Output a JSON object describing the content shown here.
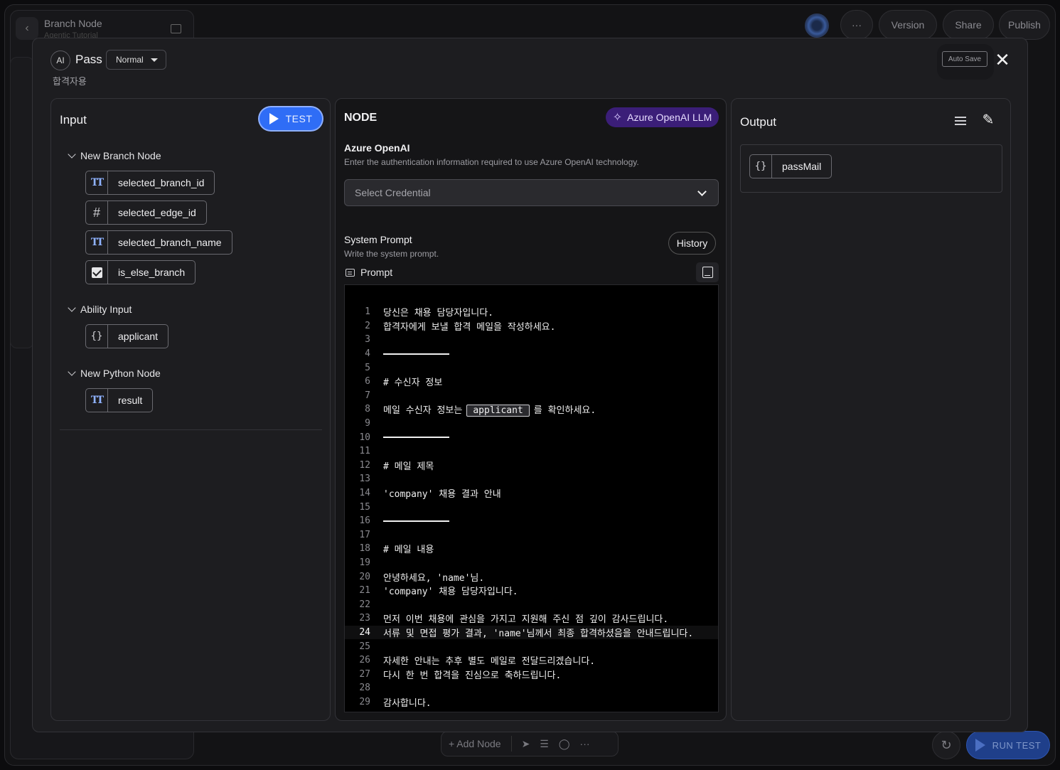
{
  "background": {
    "title": "Branch Node",
    "subtitle": "Agentic Tutorial",
    "top_buttons": {
      "more": "···",
      "version": "Version",
      "share": "Share",
      "publish": "Publish"
    },
    "bottom_toolbar": {
      "add_node": "+ Add Node"
    },
    "run_test": "RUN TEST"
  },
  "modal": {
    "ai_badge": "AI",
    "node_name": "Pass",
    "mode": "Normal",
    "description": "합격자용",
    "auto_save": "Auto Save",
    "close": "✕",
    "input_panel": {
      "title": "Input",
      "test_label": "TEST",
      "groups": [
        {
          "label": "New Branch Node",
          "items": [
            {
              "icon": "text-type-icon",
              "label": "selected_branch_id"
            },
            {
              "icon": "hash-icon",
              "label": "selected_edge_id"
            },
            {
              "icon": "text-type-icon",
              "label": "selected_branch_name"
            },
            {
              "icon": "checkbox-icon",
              "label": "is_else_branch"
            }
          ]
        },
        {
          "label": "Ability Input",
          "items": [
            {
              "icon": "object-braces-icon",
              "label": "applicant"
            }
          ]
        },
        {
          "label": "New Python Node",
          "items": [
            {
              "icon": "text-type-icon",
              "label": "result"
            }
          ]
        }
      ]
    },
    "node_panel": {
      "title": "NODE",
      "llm_badge": "Azure OpenAI LLM",
      "provider_title": "Azure OpenAI",
      "provider_desc": "Enter the authentication information required to use Azure OpenAI technology.",
      "credential_placeholder": "Select Credential",
      "system_prompt_title": "System Prompt",
      "system_prompt_desc": "Write the system prompt.",
      "history_label": "History",
      "prompt_label": "Prompt",
      "active_line": 24,
      "lines": [
        "당신은 채용 담당자입니다.",
        "합격자에게 보낼 합격 메일을 작성하세요.",
        "",
        "__RULE__",
        "",
        "# 수신자 정보",
        "",
        "__VAR__",
        "",
        "__RULE__",
        "",
        "# 메일 제목",
        "",
        "'company' 채용 결과 안내",
        "",
        "__RULE__",
        "",
        "# 메일 내용",
        "",
        "안녕하세요, 'name'님.",
        "'company' 채용 담당자입니다.",
        "",
        "먼저 이번 채용에 관심을 가지고 지원해 주신 점 깊이 감사드립니다.",
        "서류 및 면접 평가 결과, 'name'님께서 최종 합격하셨음을 안내드립니다.",
        "",
        "자세한 안내는 추후 별도 메일로 전달드리겠습니다.",
        "다시 한 번 합격을 진심으로 축하드립니다.",
        "",
        "감사합니다.",
        ""
      ],
      "line8": {
        "before": "메일 수신자 정보는",
        "var": "applicant",
        "after": "를 확인하세요."
      }
    },
    "output_panel": {
      "title": "Output",
      "items": [
        {
          "icon": "object-braces-icon",
          "label": "passMail"
        }
      ]
    }
  }
}
